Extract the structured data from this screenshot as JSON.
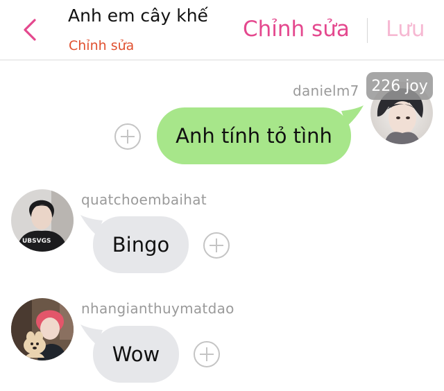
{
  "header": {
    "title": "Anh em cây khế",
    "subtitle": "Chỉnh sửa",
    "edit_label": "Chỉnh sửa",
    "save_label": "Lưu"
  },
  "messages": [
    {
      "sender": "danielm7",
      "text": "Anh tính tỏ tình",
      "badge": "226 joy",
      "outgoing": true
    },
    {
      "sender": "quatchoembaihat",
      "text": "Bingo",
      "outgoing": false
    },
    {
      "sender": "nhangianthuymatdao",
      "text": "Wow",
      "outgoing": false
    }
  ],
  "avatar_shirt_text": "UBSVGS",
  "colors": {
    "accent_pink": "#e4488e",
    "save_disabled": "#f6b8d2",
    "subtitle_orange": "#e0502f",
    "bubble_out": "#a7e68a",
    "bubble_in": "#e6e7ea",
    "username_gray": "#9a9a9a"
  },
  "icons": [
    "chevron-left-icon",
    "plus-circle-icon"
  ]
}
